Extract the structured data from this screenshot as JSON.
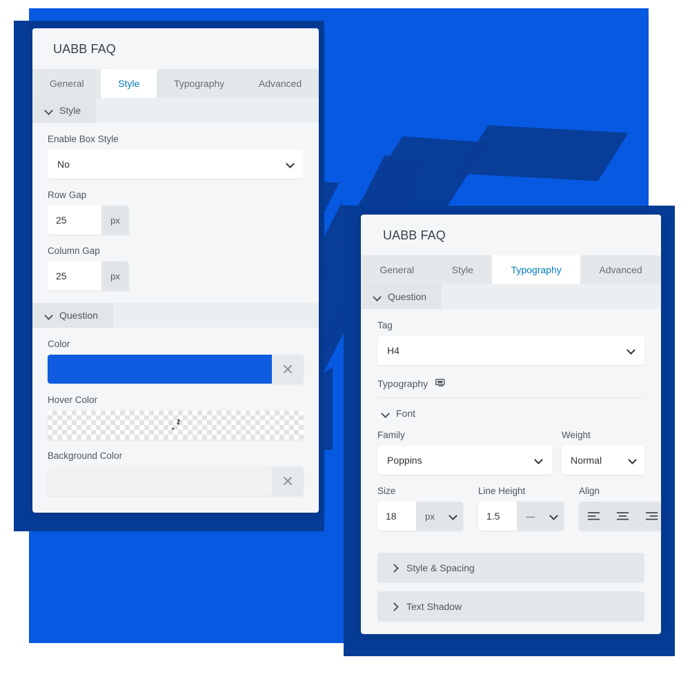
{
  "colors": {
    "background_blue": "#0659e0",
    "frame_navy": "#063c96",
    "panel_bg": "#f4f6f8",
    "tab_active_text": "#007cba",
    "question_color_swatch": "#0f5ce0"
  },
  "panel_style": {
    "title": "UABB FAQ",
    "tabs": [
      {
        "label": "General",
        "active": false
      },
      {
        "label": "Style",
        "active": true
      },
      {
        "label": "Typography",
        "active": false
      },
      {
        "label": "Advanced",
        "active": false
      }
    ],
    "sections": [
      {
        "label": "Style"
      },
      {
        "label": "Question"
      }
    ],
    "fields": {
      "enable_box_style": {
        "label": "Enable Box Style",
        "value": "No"
      },
      "row_gap": {
        "label": "Row Gap",
        "value": "25",
        "unit": "px"
      },
      "column_gap": {
        "label": "Column Gap",
        "value": "25",
        "unit": "px"
      },
      "color": {
        "label": "Color",
        "value": "#0f5ce0"
      },
      "hover_color": {
        "label": "Hover Color",
        "value": ""
      },
      "background_color": {
        "label": "Background Color",
        "value": ""
      }
    }
  },
  "panel_typography": {
    "title": "UABB FAQ",
    "tabs": [
      {
        "label": "General",
        "active": false
      },
      {
        "label": "Style",
        "active": false
      },
      {
        "label": "Typography",
        "active": true
      },
      {
        "label": "Advanced",
        "active": false
      }
    ],
    "section": {
      "label": "Question"
    },
    "fields": {
      "tag": {
        "label": "Tag",
        "value": "H4"
      },
      "typography": {
        "label": "Typography",
        "icon": "desktop-monitor-icon"
      },
      "font": {
        "label": "Font"
      },
      "family": {
        "label": "Family",
        "value": "Poppins"
      },
      "weight": {
        "label": "Weight",
        "value": "Normal"
      },
      "size": {
        "label": "Size",
        "value": "18",
        "unit": "px"
      },
      "line_height": {
        "label": "Line Height",
        "value": "1.5",
        "unit": "—"
      },
      "align": {
        "label": "Align",
        "options": [
          "align-left",
          "align-center",
          "align-right"
        ]
      }
    },
    "accordions": [
      {
        "label": "Style & Spacing",
        "expanded": false
      },
      {
        "label": "Text Shadow",
        "expanded": false
      }
    ]
  }
}
